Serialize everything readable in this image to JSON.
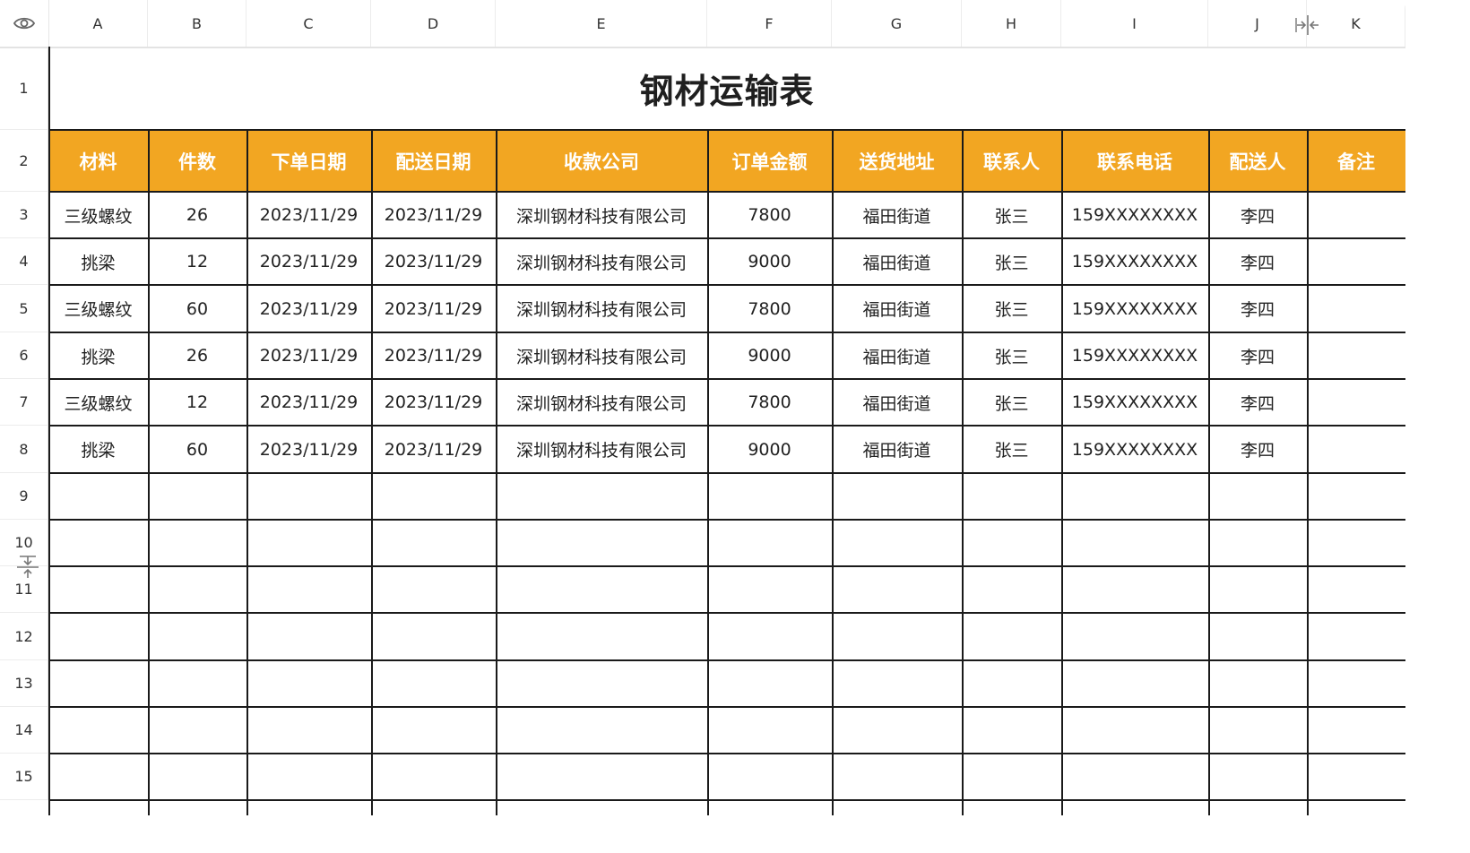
{
  "column_headers": [
    "A",
    "B",
    "C",
    "D",
    "E",
    "F",
    "G",
    "H",
    "I",
    "J",
    "K"
  ],
  "row_headers": [
    "1",
    "2",
    "3",
    "4",
    "5",
    "6",
    "7",
    "8",
    "9",
    "10",
    "11",
    "12",
    "13",
    "14",
    "15"
  ],
  "title": "钢材运输表",
  "table_headers": [
    "材料",
    "件数",
    "下单日期",
    "配送日期",
    "收款公司",
    "订单金额",
    "送货地址",
    "联系人",
    "联系电话",
    "配送人",
    "备注"
  ],
  "rows": [
    [
      "三级螺纹",
      "26",
      "2023/11/29",
      "2023/11/29",
      "深圳钢材科技有限公司",
      "7800",
      "福田街道",
      "张三",
      "159XXXXXXXX",
      "李四",
      ""
    ],
    [
      "挑梁",
      "12",
      "2023/11/29",
      "2023/11/29",
      "深圳钢材科技有限公司",
      "9000",
      "福田街道",
      "张三",
      "159XXXXXXXX",
      "李四",
      ""
    ],
    [
      "三级螺纹",
      "60",
      "2023/11/29",
      "2023/11/29",
      "深圳钢材科技有限公司",
      "7800",
      "福田街道",
      "张三",
      "159XXXXXXXX",
      "李四",
      ""
    ],
    [
      "挑梁",
      "26",
      "2023/11/29",
      "2023/11/29",
      "深圳钢材科技有限公司",
      "9000",
      "福田街道",
      "张三",
      "159XXXXXXXX",
      "李四",
      ""
    ],
    [
      "三级螺纹",
      "12",
      "2023/11/29",
      "2023/11/29",
      "深圳钢材科技有限公司",
      "7800",
      "福田街道",
      "张三",
      "159XXXXXXXX",
      "李四",
      ""
    ],
    [
      "挑梁",
      "60",
      "2023/11/29",
      "2023/11/29",
      "深圳钢材科技有限公司",
      "9000",
      "福田街道",
      "张三",
      "159XXXXXXXX",
      "李四",
      ""
    ]
  ],
  "colors": {
    "header_fill": "#F2A622",
    "header_text": "#ffffff",
    "grid_line": "#1a1a1a"
  },
  "icons": {
    "corner": "eye-icon",
    "column_resize": "column-resize-icon",
    "row_resize": "row-resize-icon"
  }
}
